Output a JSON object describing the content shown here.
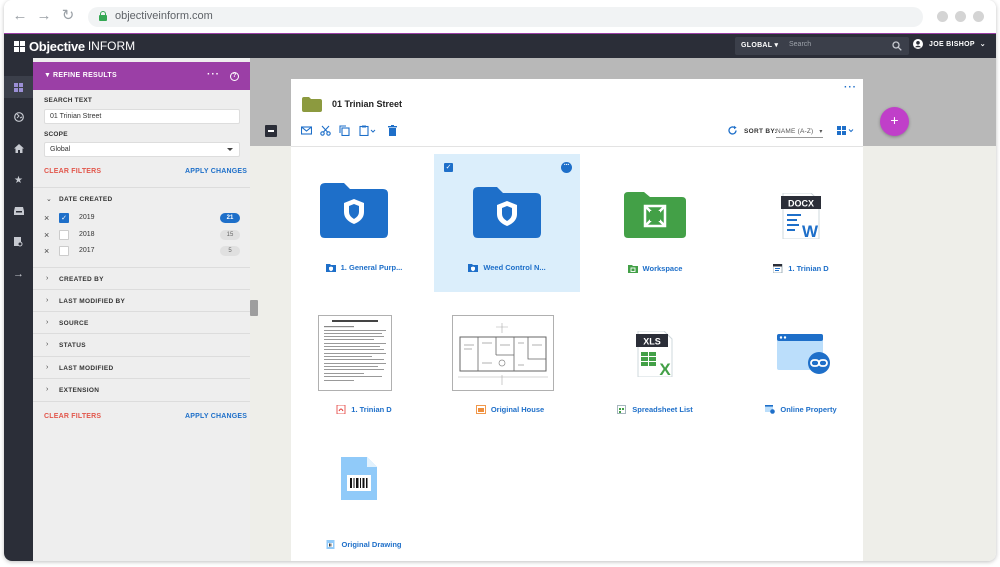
{
  "browser": {
    "url": "objectiveinform.com"
  },
  "header": {
    "logo_bold": "Objective",
    "logo_light": "INFORM",
    "scope_label": "GLOBAL",
    "search_placeholder": "Search",
    "user_name": "JOE BISHOP"
  },
  "rail": {
    "items": [
      "dashboard-icon",
      "globe-icon",
      "home-icon",
      "star-icon",
      "inbox-icon",
      "search-doc-icon",
      "arrow-right-icon"
    ]
  },
  "filter": {
    "title": "REFINE RESULTS",
    "search_text_label": "SEARCH TEXT",
    "search_text_value": "01 Trinian Street",
    "scope_label": "SCOPE",
    "scope_value": "Global",
    "clear_label": "CLEAR FILTERS",
    "apply_label": "APPLY CHANGES",
    "date_section": "DATE CREATED",
    "years": [
      {
        "year": "2019",
        "count": "21",
        "checked": true
      },
      {
        "year": "2018",
        "count": "15",
        "checked": false
      },
      {
        "year": "2017",
        "count": "5",
        "checked": false
      }
    ],
    "sections": [
      "CREATED BY",
      "LAST MODIFIED BY",
      "SOURCE",
      "STATUS",
      "LAST MODIFIED",
      "EXTENSION"
    ]
  },
  "panel": {
    "title": "01 Trinian Street",
    "sort_label": "SORT BY:",
    "sort_value": "NAME (A-Z)",
    "items": [
      {
        "label": "1. General Purp...",
        "type": "secure-folder",
        "selected": false
      },
      {
        "label": "Weed Control N...",
        "type": "secure-folder",
        "selected": true
      },
      {
        "label": "Workspace",
        "type": "workspace-folder",
        "selected": false
      },
      {
        "label": "1. Trinian D",
        "type": "docx",
        "selected": false
      },
      {
        "label": "1. Trinian D",
        "type": "pdf",
        "selected": false
      },
      {
        "label": "Original House",
        "type": "drawing",
        "selected": false
      },
      {
        "label": "Spreadsheet List",
        "type": "xls",
        "selected": false
      },
      {
        "label": "Online Property",
        "type": "web-link",
        "selected": false
      },
      {
        "label": "Original Drawing",
        "type": "barcode-file",
        "selected": false
      }
    ]
  },
  "colors": {
    "accent": "#9b3fa6",
    "primary": "#1e6fc9",
    "header_bg": "#2b2e38",
    "fab": "#c03fc9"
  }
}
